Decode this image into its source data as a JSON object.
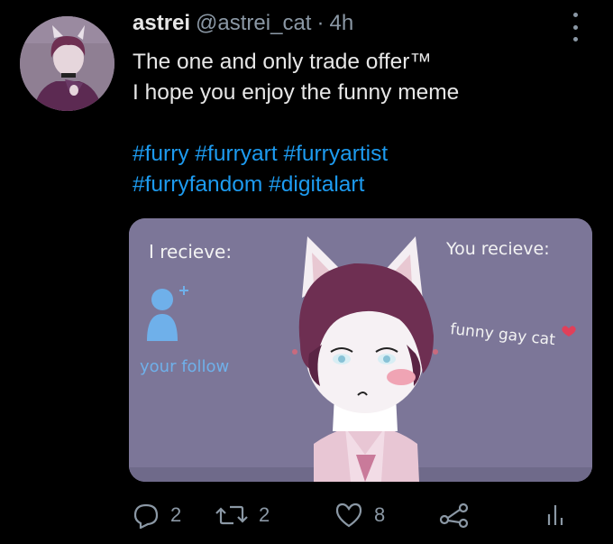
{
  "tweet": {
    "display_name": "astrei",
    "handle": "@astrei_cat",
    "separator": "·",
    "time": "4h",
    "text_line1": "The one and only trade offer™",
    "text_line2": "I hope you enjoy the funny meme",
    "hashtags_line1": "#furry #furryart #furryartist",
    "hashtags_line2": "#furryfandom #digitalart"
  },
  "media": {
    "label_left": "I recieve:",
    "label_right": "You recieve:",
    "follow_caption": "your follow",
    "cat_caption": "funny gay cat"
  },
  "actions": {
    "reply_count": "2",
    "retweet_count": "2",
    "like_count": "8"
  },
  "icons": [
    "more-icon",
    "reply-icon",
    "retweet-icon",
    "like-icon",
    "share-icon",
    "analytics-icon",
    "add-user-icon",
    "heart-icon"
  ],
  "colors": {
    "background": "#000000",
    "text": "#e7e7e7",
    "muted": "#8b98a5",
    "link": "#1d9bf0",
    "image_bg": "#7c7698",
    "follow_blue": "#6fb0ea",
    "hair_purple": "#6e2f52"
  }
}
